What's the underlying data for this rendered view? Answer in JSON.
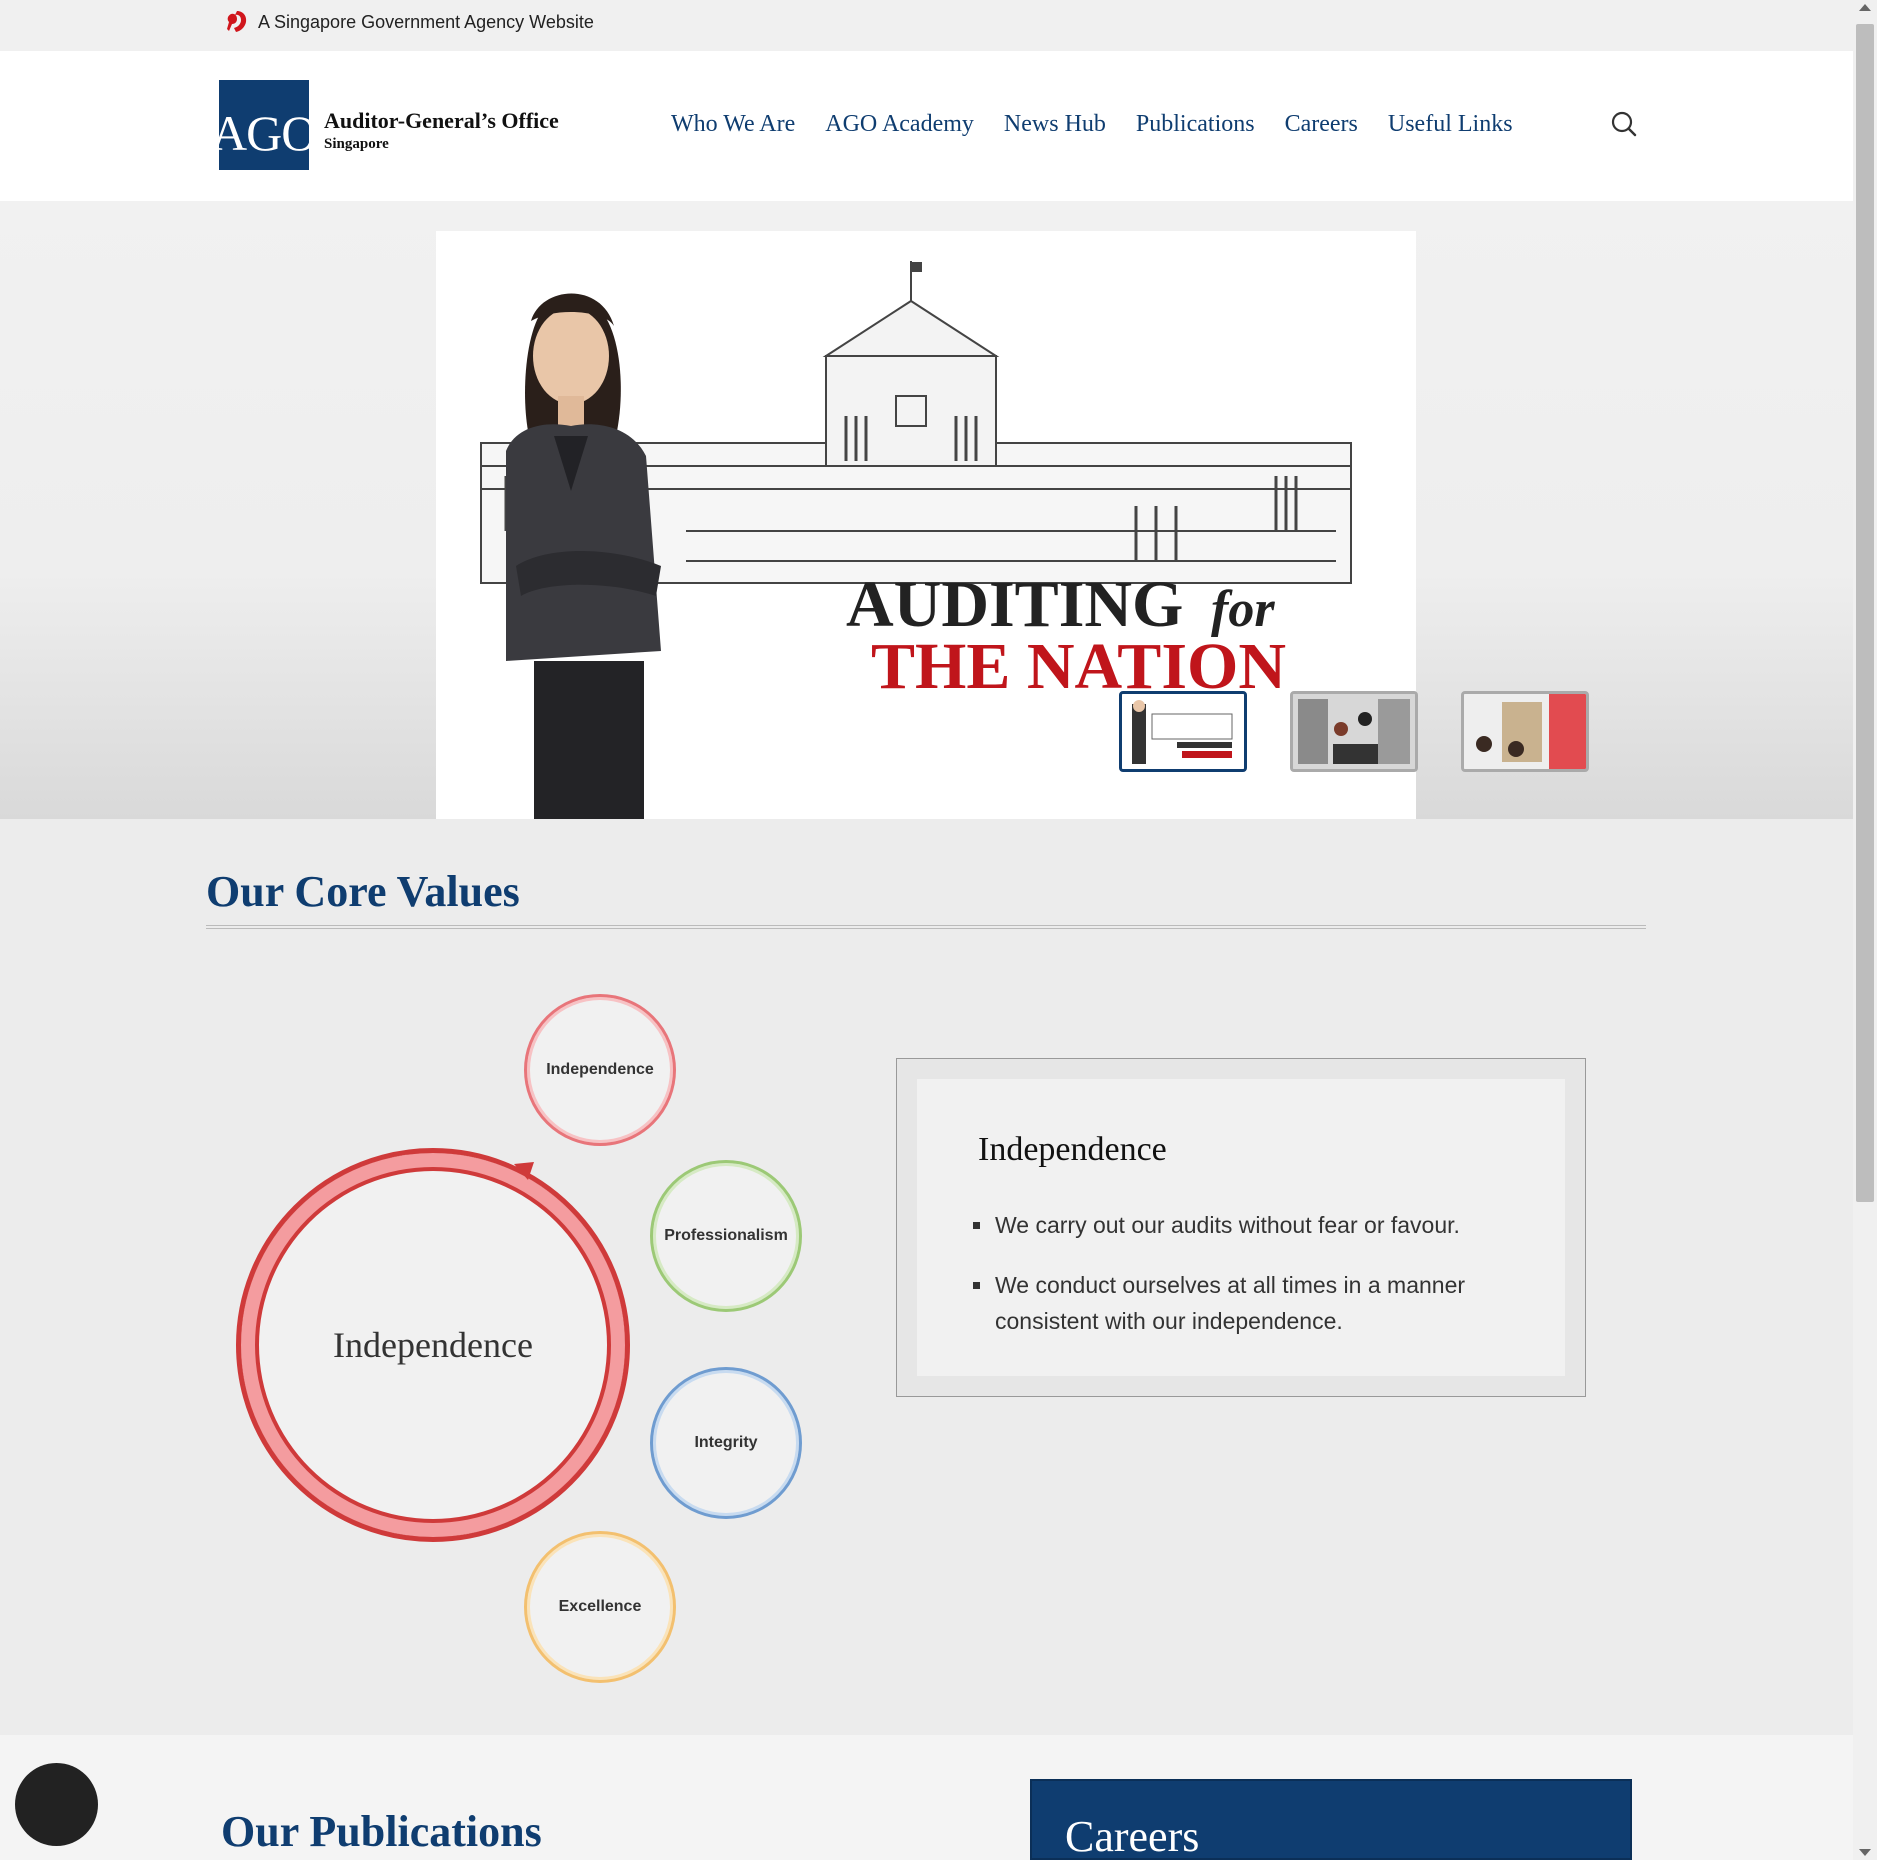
{
  "masthead": {
    "text": "A Singapore Government Agency Website",
    "icon": "lion-head-icon"
  },
  "logo": {
    "mark": "AGO",
    "name": "Auditor-General’s Office",
    "sub": "Singapore",
    "brand_color": "#0f3d70"
  },
  "nav": {
    "items": [
      {
        "label": "Who We Are"
      },
      {
        "label": "AGO Academy"
      },
      {
        "label": "News Hub"
      },
      {
        "label": "Publications"
      },
      {
        "label": "Careers"
      },
      {
        "label": "Useful Links"
      }
    ],
    "search_icon": "search-icon"
  },
  "hero": {
    "headline_line1": "AUDITING",
    "headline_for": "for",
    "headline_line2": "THE NATION",
    "headline_color": "#c0151b",
    "thumbnails": [
      {
        "name": "slide-1",
        "active": true
      },
      {
        "name": "slide-2",
        "active": false
      },
      {
        "name": "slide-3",
        "active": false
      }
    ]
  },
  "core_values": {
    "title": "Our Core Values",
    "selected": "Independence",
    "values": [
      {
        "label": "Independence",
        "color": "#e8757a"
      },
      {
        "label": "Professionalism",
        "color": "#9cc976"
      },
      {
        "label": "Integrity",
        "color": "#6f9cd0"
      },
      {
        "label": "Excellence",
        "color": "#f3c06f"
      }
    ],
    "detail": {
      "title": "Independence",
      "points": [
        "We carry out our audits without fear or favour.",
        "We conduct ourselves at all times in a manner consistent with our independence."
      ]
    }
  },
  "bottom": {
    "publications_title": "Our Publications",
    "careers_title": "Careers"
  }
}
